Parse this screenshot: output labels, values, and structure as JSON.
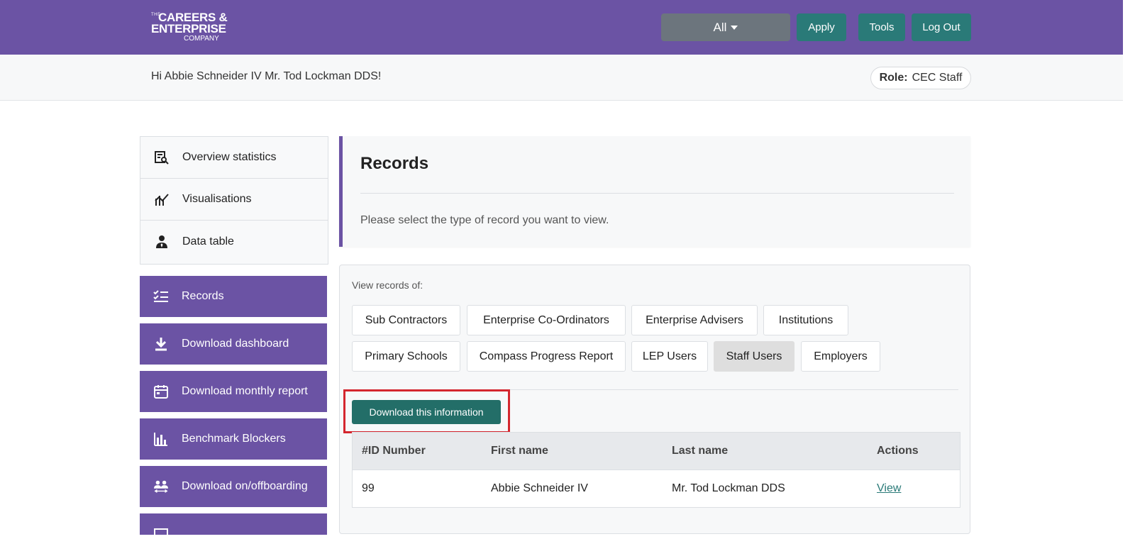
{
  "header": {
    "logo": {
      "the": "THE",
      "line1": "CAREERS &",
      "line2": "ENTERPRISE",
      "line3": "COMPANY"
    },
    "filter_select": "All",
    "buttons": {
      "apply": "Apply",
      "tools": "Tools",
      "logout": "Log Out"
    },
    "colors": {
      "brand": "#6b53a4",
      "teal": "#2a7a78",
      "select": "#6c757d"
    }
  },
  "welcome": {
    "greeting": "Hi Abbie Schneider IV Mr. Tod Lockman DDS!",
    "role_label": "Role:",
    "role_value": "CEC Staff"
  },
  "sidebar": {
    "top_items": [
      {
        "label": "Overview statistics",
        "icon": "report-search-icon"
      },
      {
        "label": "Visualisations",
        "icon": "chart-line-icon"
      },
      {
        "label": "Data table",
        "icon": "user-tie-icon"
      }
    ],
    "buttons": [
      {
        "label": "Records",
        "icon": "checklist-icon"
      },
      {
        "label": "Download dashboard",
        "icon": "download-icon"
      },
      {
        "label": "Download monthly report",
        "icon": "calendar-icon"
      },
      {
        "label": "Benchmark Blockers",
        "icon": "bar-chart-icon"
      },
      {
        "label": "Download on/offboarding",
        "icon": "users-swap-icon"
      }
    ]
  },
  "records": {
    "title": "Records",
    "description": "Please select the type of record you want to view."
  },
  "filters": {
    "label": "View records of:",
    "row1": [
      "Sub Contractors",
      "Enterprise Co-Ordinators",
      "Enterprise Advisers",
      "Institutions"
    ],
    "row2": [
      "Primary Schools",
      "Compass Progress Report",
      "LEP Users",
      "Staff Users",
      "Employers"
    ],
    "active": "Staff Users"
  },
  "download_button": "Download this information",
  "table": {
    "headers": [
      "#ID Number",
      "First name",
      "Last name",
      "Actions"
    ],
    "rows": [
      {
        "id": "99",
        "first_name": "Abbie Schneider IV",
        "last_name": "Mr. Tod Lockman DDS",
        "action": "View"
      }
    ]
  }
}
